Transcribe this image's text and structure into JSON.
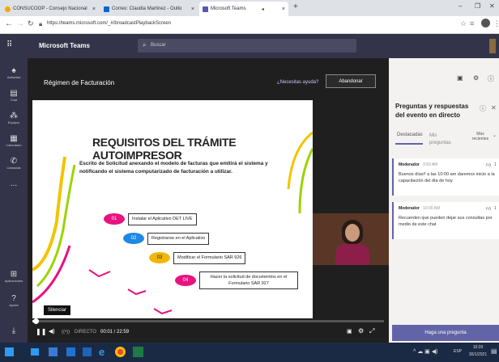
{
  "browser": {
    "tabs": [
      {
        "title": "CONSUCOOP - Consejo Nacional",
        "close": "×"
      },
      {
        "title": "Correo: Claudia Martinez - Outlo",
        "close": "×"
      },
      {
        "title": "Microsoft Teams",
        "close": "×"
      }
    ],
    "new_tab": "+",
    "url": "https://teams.microsoft.com/_#/broadcastPlaybackScreen"
  },
  "teams": {
    "app_name": "Microsoft Teams",
    "search_placeholder": "Buscar",
    "rail": [
      {
        "label": "Actividad",
        "icon": "bell-icon"
      },
      {
        "label": "Chat",
        "icon": "chat-icon"
      },
      {
        "label": "Equipos",
        "icon": "teams-icon"
      },
      {
        "label": "Calendario",
        "icon": "calendar-icon"
      },
      {
        "label": "Llamadas",
        "icon": "phone-icon"
      },
      {
        "label": "...",
        "icon": "more-icon"
      }
    ],
    "rail_bottom": [
      {
        "label": "Aplicaciones",
        "icon": "apps-icon"
      },
      {
        "label": "Ayuda",
        "icon": "help-icon"
      }
    ]
  },
  "event": {
    "title": "Régimen de Facturación",
    "help_link": "¿Necesitas ayuda?",
    "leave_button": "Abandonar"
  },
  "slide": {
    "heading": "REQUISITOS DEL TRÁMITE AUTOIMPRESOR",
    "body": "Escrito de Solicitud anexando el modelo de facturas que emitirá el sistema y notificando el sistema computarizado de facturación a utilizar.",
    "steps": [
      {
        "num": "01",
        "text": "Instalar el Aplicativo DET LIVE",
        "color": "#e8137f"
      },
      {
        "num": "02",
        "text": "Registrarse en el Aplicativo",
        "color": "#1e88e5"
      },
      {
        "num": "03",
        "text": "Modificar el Formulario SAR 926",
        "color": "#f2b705"
      },
      {
        "num": "04",
        "text": "Hacer la solicitud de documentos en el Formulario SAR 927",
        "color": "#e8137f"
      }
    ]
  },
  "player": {
    "tooltip": "Silenciar",
    "live": "DIRECTO",
    "time": "00:01 / 22:59",
    "progress": 0.01
  },
  "qa": {
    "title": "Preguntas y respuestas del evento en directo",
    "tabs": [
      "Destacadas",
      "Mis preguntas"
    ],
    "sort": "Más recientes",
    "posts": [
      {
        "author": "Moderador",
        "time": "9:59 AM",
        "likes": "1",
        "text": "Buenos días!! a las 10:00 am daremos inicio a la capacitación del día de hoy."
      },
      {
        "author": "Moderador",
        "time": "10:00 AM",
        "likes": "1",
        "text": "Recuerden que pueden dejar sus consultas por medio de este chat"
      }
    ],
    "ask_button": "Haga una pregunta"
  },
  "taskbar": {
    "lang": "ESP",
    "time": "10:20",
    "date": "30/1/2021"
  }
}
